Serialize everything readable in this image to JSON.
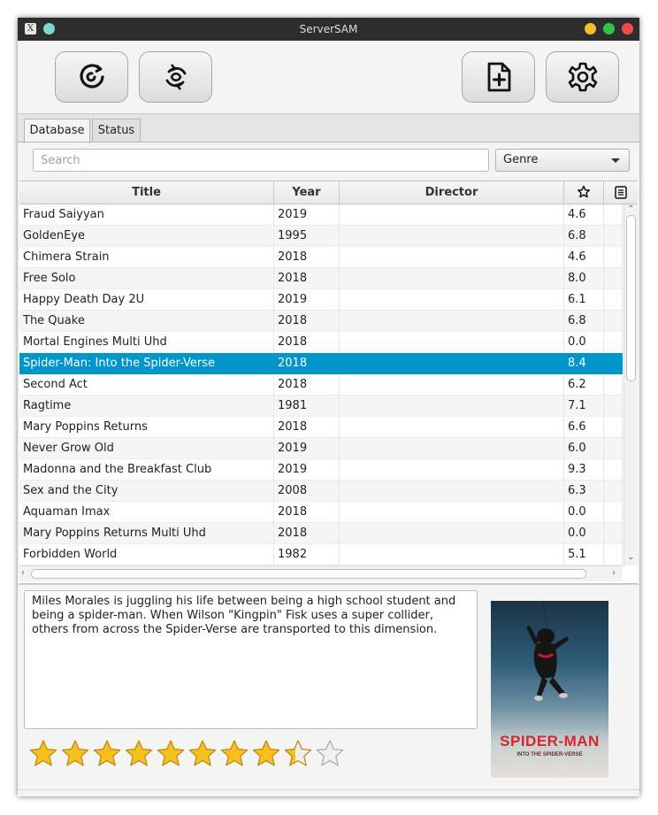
{
  "window": {
    "title": "ServerSAM",
    "app_icon_glyph": "X",
    "controls": {
      "minimize_color": "#f5bf2a",
      "maximize_color": "#2fc443",
      "close_color": "#f14b4b"
    }
  },
  "toolbar": {
    "buttons": [
      {
        "icon": "refresh-icon"
      },
      {
        "icon": "sync-icon"
      },
      {
        "icon": "add-file-icon"
      },
      {
        "icon": "gear-icon"
      }
    ]
  },
  "tabs": [
    {
      "label": "Database",
      "active": true
    },
    {
      "label": "Status",
      "active": false
    }
  ],
  "search": {
    "placeholder": "Search",
    "value": ""
  },
  "genre_select": {
    "selected": "Genre"
  },
  "table": {
    "columns": [
      "Title",
      "Year",
      "Director",
      "",
      ""
    ],
    "column_icons": [
      "",
      "",
      "",
      "star-icon",
      "list-icon"
    ],
    "selected_index": 7,
    "rows": [
      {
        "title": "Fraud Saiyyan",
        "year": "2019",
        "director": "",
        "rating": "4.6"
      },
      {
        "title": "GoldenEye",
        "year": "1995",
        "director": "",
        "rating": "6.8"
      },
      {
        "title": "Chimera Strain",
        "year": "2018",
        "director": "",
        "rating": "4.6"
      },
      {
        "title": "Free Solo",
        "year": "2018",
        "director": "",
        "rating": "8.0"
      },
      {
        "title": "Happy Death Day 2U",
        "year": "2019",
        "director": "",
        "rating": "6.1"
      },
      {
        "title": "The Quake",
        "year": "2018",
        "director": "",
        "rating": "6.8"
      },
      {
        "title": "Mortal Engines Multi Uhd",
        "year": "2018",
        "director": "",
        "rating": "0.0"
      },
      {
        "title": "Spider-Man: Into the Spider-Verse",
        "year": "2018",
        "director": "",
        "rating": "8.4"
      },
      {
        "title": "Second Act",
        "year": "2018",
        "director": "",
        "rating": "6.2"
      },
      {
        "title": "Ragtime",
        "year": "1981",
        "director": "",
        "rating": "7.1"
      },
      {
        "title": "Mary Poppins Returns",
        "year": "2018",
        "director": "",
        "rating": "6.6"
      },
      {
        "title": "Never Grow Old",
        "year": "2019",
        "director": "",
        "rating": "6.0"
      },
      {
        "title": "Madonna and the Breakfast Club",
        "year": "2019",
        "director": "",
        "rating": "9.3"
      },
      {
        "title": "Sex and the City",
        "year": "2008",
        "director": "",
        "rating": "6.3"
      },
      {
        "title": "Aquaman Imax",
        "year": "2018",
        "director": "",
        "rating": "0.0"
      },
      {
        "title": "Mary Poppins Returns Multi Uhd",
        "year": "2018",
        "director": "",
        "rating": "0.0"
      },
      {
        "title": "Forbidden World",
        "year": "1982",
        "director": "",
        "rating": "5.1"
      }
    ]
  },
  "details": {
    "description": "Miles Morales is juggling his life between being a high school student and being a spider-man. When Wilson \"Kingpin\" Fisk uses a super collider, others from across the Spider-Verse are transported to this dimension.",
    "rating_value": 8.4,
    "rating_max": 10,
    "poster": {
      "title": "SPIDER-MAN",
      "subtitle": "INTO THE SPIDER-VERSE"
    }
  },
  "colors": {
    "selection": "#0096c9",
    "star_fill": "#f7c01e",
    "star_empty": "#f0f0f0"
  }
}
